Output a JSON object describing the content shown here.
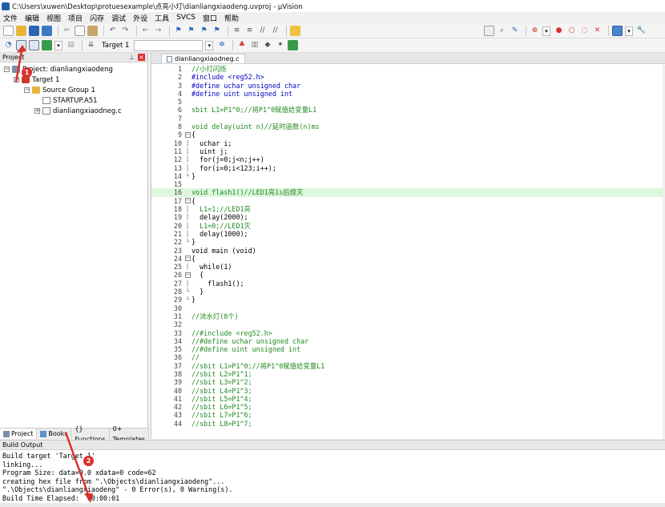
{
  "window": {
    "title": "C:\\Users\\xuwen\\Desktop\\protuesexample\\点亮小灯\\dianliangxiaodeng.uvproj - µVision"
  },
  "menu": [
    "文件",
    "编辑",
    "视图",
    "项目",
    "闪存",
    "调试",
    "外设",
    "工具",
    "SVCS",
    "窗口",
    "帮助"
  ],
  "toolbar2": {
    "target_label": "Target 1"
  },
  "project_pane": {
    "header": "Project",
    "tree": {
      "project": "Project: dianliangxiaodeng",
      "target": "Target 1",
      "group": "Source Group 1",
      "files": [
        "STARTUP.A51",
        "dianliangxiaodneg.c"
      ]
    },
    "tabs": [
      "Project",
      "Books",
      "{} Functions",
      "0+ Templates"
    ]
  },
  "editor": {
    "tab": "dianliangxiaodneg.c",
    "lines": [
      {
        "n": "1",
        "f": "",
        "t": "//小灯闪烁",
        "c": "comment"
      },
      {
        "n": "2",
        "f": "",
        "t": "#include <reg52.h>",
        "c": "kw"
      },
      {
        "n": "3",
        "f": "",
        "t": "#define uchar unsigned char",
        "c": "kw"
      },
      {
        "n": "4",
        "f": "",
        "t": "#define uint unsigned int",
        "c": "kw"
      },
      {
        "n": "5",
        "f": "",
        "t": "",
        "c": "plain"
      },
      {
        "n": "6",
        "f": "",
        "t": "sbit L1=P1^0;//将P1^0赋值给变量L1",
        "c": "comment"
      },
      {
        "n": "7",
        "f": "",
        "t": "",
        "c": "plain"
      },
      {
        "n": "8",
        "f": "",
        "t": "void delay(uint n)//延时函数(n)ms",
        "c": "comment"
      },
      {
        "n": "9",
        "f": "box",
        "t": "{",
        "c": "plain"
      },
      {
        "n": "10",
        "f": "│",
        "t": "  uchar i;",
        "c": "plain"
      },
      {
        "n": "11",
        "f": "│",
        "t": "  uint j;",
        "c": "plain"
      },
      {
        "n": "12",
        "f": "│",
        "t": "  for(j=0;j<n;j++)",
        "c": "plain"
      },
      {
        "n": "13",
        "f": "│",
        "t": "  for(i=0;i<123;i++);",
        "c": "plain"
      },
      {
        "n": "14",
        "f": "└",
        "t": "}",
        "c": "plain"
      },
      {
        "n": "15",
        "f": "",
        "t": "",
        "c": "plain"
      },
      {
        "n": "16",
        "f": "",
        "t": "void flash1()//LED1亮1s后熄灭",
        "c": "comment",
        "hl": true
      },
      {
        "n": "17",
        "f": "box",
        "t": "{",
        "c": "plain"
      },
      {
        "n": "18",
        "f": "│",
        "t": "  L1=1;//LED1亮",
        "c": "comment"
      },
      {
        "n": "19",
        "f": "│",
        "t": "  delay(2000);",
        "c": "plain"
      },
      {
        "n": "20",
        "f": "│",
        "t": "  L1=0;//LED1灭",
        "c": "comment"
      },
      {
        "n": "21",
        "f": "│",
        "t": "  delay(1000);",
        "c": "plain"
      },
      {
        "n": "22",
        "f": "└",
        "t": "}",
        "c": "plain"
      },
      {
        "n": "23",
        "f": "",
        "t": "void main (void)",
        "c": "plain"
      },
      {
        "n": "24",
        "f": "box",
        "t": "{",
        "c": "plain"
      },
      {
        "n": "25",
        "f": "│",
        "t": "  while(1)",
        "c": "plain"
      },
      {
        "n": "26",
        "f": "box",
        "t": "  {",
        "c": "plain"
      },
      {
        "n": "27",
        "f": "│",
        "t": "    flash1();",
        "c": "plain"
      },
      {
        "n": "28",
        "f": "└",
        "t": "  }",
        "c": "plain"
      },
      {
        "n": "29",
        "f": "└",
        "t": "}",
        "c": "plain"
      },
      {
        "n": "30",
        "f": "",
        "t": "",
        "c": "plain"
      },
      {
        "n": "31",
        "f": "",
        "t": "//流水灯(8个)",
        "c": "comment"
      },
      {
        "n": "32",
        "f": "",
        "t": "",
        "c": "plain"
      },
      {
        "n": "33",
        "f": "",
        "t": "//#include <reg52.h>",
        "c": "comment"
      },
      {
        "n": "34",
        "f": "",
        "t": "//#define uchar unsigned char",
        "c": "comment"
      },
      {
        "n": "35",
        "f": "",
        "t": "//#define uint unsigned int",
        "c": "comment"
      },
      {
        "n": "36",
        "f": "",
        "t": "//",
        "c": "comment"
      },
      {
        "n": "37",
        "f": "",
        "t": "//sbit L1=P1^0;//将P1^0赋值给变量L1",
        "c": "comment"
      },
      {
        "n": "38",
        "f": "",
        "t": "//sbit L2=P1^1;",
        "c": "comment"
      },
      {
        "n": "39",
        "f": "",
        "t": "//sbit L3=P1^2;",
        "c": "comment"
      },
      {
        "n": "40",
        "f": "",
        "t": "//sbit L4=P1^3;",
        "c": "comment"
      },
      {
        "n": "41",
        "f": "",
        "t": "//sbit L5=P1^4;",
        "c": "comment"
      },
      {
        "n": "42",
        "f": "",
        "t": "//sbit L6=P1^5;",
        "c": "comment"
      },
      {
        "n": "43",
        "f": "",
        "t": "//sbit L7=P1^6;",
        "c": "comment"
      },
      {
        "n": "44",
        "f": "",
        "t": "//sbit L8=P1^7;",
        "c": "comment"
      }
    ]
  },
  "build_output": {
    "header": "Build Output",
    "lines": [
      "Build target 'Target 1'",
      "linking...",
      "Program Size: data=9.0 xdata=0 code=62",
      "creating hex file from \".\\Objects\\dianliangxiaodeng\"...",
      "\".\\Objects\\dianliangxiaodeng\" - 0 Error(s), 0 Warning(s).",
      "Build Time Elapsed:  00:00:01"
    ]
  },
  "annotations": {
    "badge1": "1",
    "badge2": "2",
    "arrow_color": "#d9302c"
  }
}
